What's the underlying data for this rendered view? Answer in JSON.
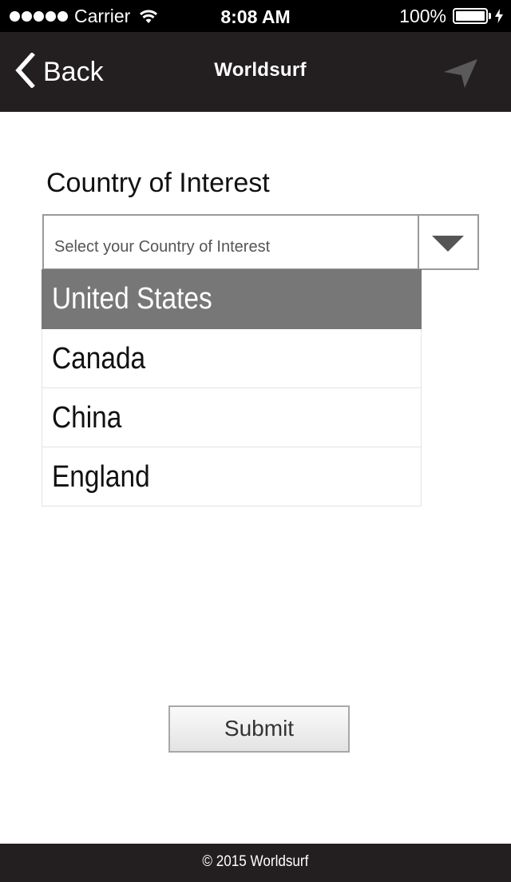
{
  "status_bar": {
    "carrier": "Carrier",
    "time": "8:08 AM",
    "battery": "100%"
  },
  "nav": {
    "back_label": "Back",
    "title": "Worldsurf",
    "back_icon": "chevron-left-icon",
    "location_icon": "location-arrow-icon"
  },
  "form": {
    "label": "Country of Interest",
    "select_placeholder": "Select your Country of Interest",
    "options": [
      {
        "label": "United States",
        "selected": true
      },
      {
        "label": "Canada",
        "selected": false
      },
      {
        "label": "China",
        "selected": false
      },
      {
        "label": "England",
        "selected": false
      }
    ],
    "submit_label": "Submit"
  },
  "footer": {
    "text": "© 2015 Worldsurf"
  },
  "colors": {
    "bar_background": "#231f20",
    "selected_option": "#777777"
  }
}
